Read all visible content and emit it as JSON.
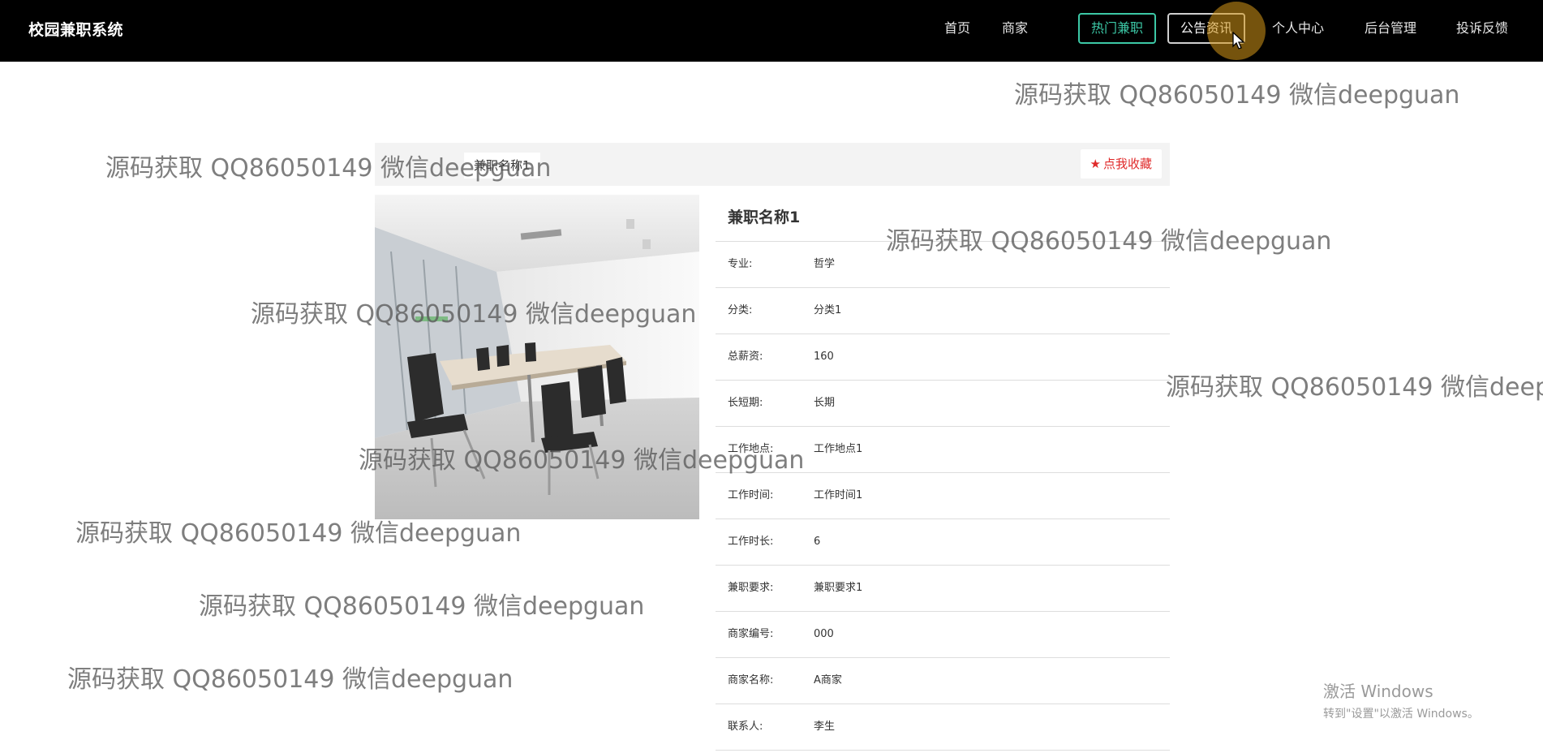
{
  "app": {
    "brand": "校园兼职系统"
  },
  "nav": {
    "items": [
      {
        "label": "首页"
      },
      {
        "label": "商家"
      },
      {
        "label": "热门兼职"
      },
      {
        "label": "公告资讯"
      },
      {
        "label": "个人中心"
      },
      {
        "label": "后台管理"
      },
      {
        "label": "投诉反馈"
      }
    ],
    "active": "热门兼职",
    "hovered": "公告资讯"
  },
  "job": {
    "title_chip": "兼职名称1",
    "favorite_label": "点我收藏",
    "name": "兼职名称1",
    "fields": [
      {
        "key": "专业:",
        "value": "哲学"
      },
      {
        "key": "分类:",
        "value": "分类1"
      },
      {
        "key": "总薪资:",
        "value": "160"
      },
      {
        "key": "长短期:",
        "value": "长期"
      },
      {
        "key": "工作地点:",
        "value": "工作地点1"
      },
      {
        "key": "工作时间:",
        "value": "工作时间1"
      },
      {
        "key": "工作时长:",
        "value": "6"
      },
      {
        "key": "兼职要求:",
        "value": "兼职要求1"
      },
      {
        "key": "商家编号:",
        "value": "000"
      },
      {
        "key": "商家名称:",
        "value": "A商家"
      },
      {
        "key": "联系人:",
        "value": "李生"
      }
    ]
  },
  "watermark": {
    "text": "源码获取 QQ86050149 微信deepguan"
  },
  "windows_notice": {
    "line1": "激活 Windows",
    "line2": "转到\"设置\"以激活 Windows。"
  },
  "colors": {
    "accent": "#3cc8a6",
    "favorite": "#e02a2a",
    "topbar": "#000000"
  },
  "icons": {
    "favorite": "star-icon",
    "cursor": "mouse-pointer-icon"
  }
}
